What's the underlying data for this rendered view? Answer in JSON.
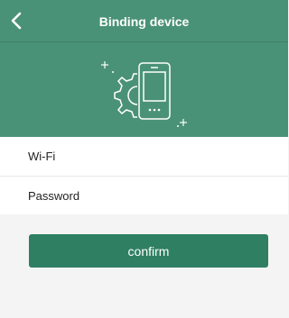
{
  "header": {
    "title": "Binding device",
    "back_icon": "chevron-left-icon",
    "illustration_icon": "phone-gear-icon",
    "bg_color": "#4a9277"
  },
  "form": {
    "wifi_label": "Wi-Fi",
    "wifi_value": "",
    "password_label": "Password",
    "password_value": ""
  },
  "actions": {
    "confirm_label": "confirm",
    "confirm_color": "#2f7f63"
  }
}
